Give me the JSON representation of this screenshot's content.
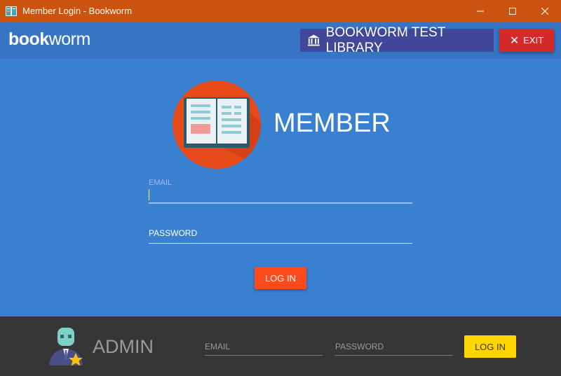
{
  "window": {
    "title": "Member Login - Bookworm",
    "controls": {
      "minimize": "—",
      "maximize": "☐",
      "close": "✕"
    }
  },
  "appbar": {
    "logo_bold": "book",
    "logo_light": "worm",
    "library_label": "BOOKWORM TEST LIBRARY",
    "exit_label": "EXIT",
    "exit_icon": "✕"
  },
  "member": {
    "title": "MEMBER",
    "email_label": "EMAIL",
    "email_value": "",
    "password_label": "PASSWORD",
    "login_label": "LOG IN"
  },
  "admin": {
    "title": "ADMIN",
    "email_label": "EMAIL",
    "password_label": "PASSWORD",
    "login_label": "LOG IN"
  },
  "colors": {
    "titlebar": "#cc5411",
    "background": "#3a80d0",
    "library_button": "#41489a",
    "exit_button": "#d42a2a",
    "login_button": "#ff4a1c",
    "admin_bar": "#363636",
    "admin_login": "#ffd600"
  },
  "icons": {
    "app": "book-icon",
    "library": "bank-icon",
    "member": "open-book-icon",
    "admin": "admin-avatar-star-icon"
  }
}
